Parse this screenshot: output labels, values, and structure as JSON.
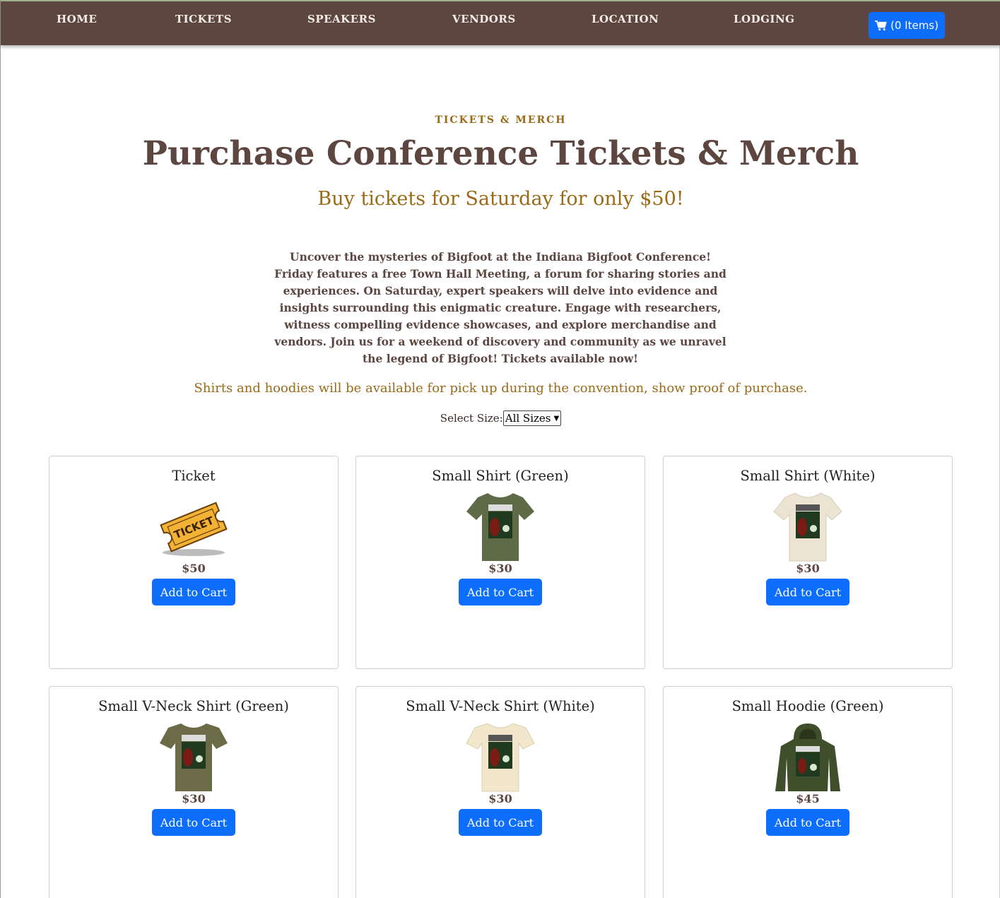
{
  "nav": {
    "items": [
      "HOME",
      "TICKETS",
      "SPEAKERS",
      "VENDORS",
      "LOCATION",
      "LODGING"
    ],
    "cart_label": "(0 Items)"
  },
  "hero": {
    "kicker": "TICKETS & MERCH",
    "title": "Purchase Conference Tickets & Merch",
    "subtitle": "Buy tickets for Saturday for only $50!",
    "description": "Uncover the mysteries of Bigfoot at the Indiana Bigfoot Conference! Friday features a free Town Hall Meeting, a forum for sharing stories and experiences. On Saturday, expert speakers will delve into evidence and insights surrounding this enigmatic creature. Engage with researchers, witness compelling evidence showcases, and explore merchandise and vendors. Join us for a weekend of discovery and community as we unravel the legend of Bigfoot! Tickets available now!",
    "note": "Shirts and hoodies will be available for pick up during the convention, show proof of purchase."
  },
  "filter": {
    "label": "Select Size:",
    "selected": "All Sizes"
  },
  "products": [
    {
      "name": "Ticket",
      "price": "$50",
      "button": "Add to Cart",
      "image": "ticket-icon",
      "color": "#f2b234"
    },
    {
      "name": "Small Shirt (Green)",
      "price": "$30",
      "button": "Add to Cart",
      "image": "tshirt-icon",
      "color": "#5f6b47"
    },
    {
      "name": "Small Shirt (White)",
      "price": "$30",
      "button": "Add to Cart",
      "image": "tshirt-icon",
      "color": "#ece3d2"
    },
    {
      "name": "Small V-Neck Shirt (Green)",
      "price": "$30",
      "button": "Add to Cart",
      "image": "tshirt-icon",
      "color": "#6b6b48"
    },
    {
      "name": "Small V-Neck Shirt (White)",
      "price": "$30",
      "button": "Add to Cart",
      "image": "tshirt-icon",
      "color": "#f2e7cc"
    },
    {
      "name": "Small Hoodie (Green)",
      "price": "$45",
      "button": "Add to Cart",
      "image": "hoodie-icon",
      "color": "#3f4f2c"
    }
  ],
  "ticket_art_text": "TICKET",
  "colors": {
    "nav_bg": "#5d4640",
    "accent": "#9a6a16",
    "button": "#0d6efd",
    "heading": "#5d4640"
  }
}
